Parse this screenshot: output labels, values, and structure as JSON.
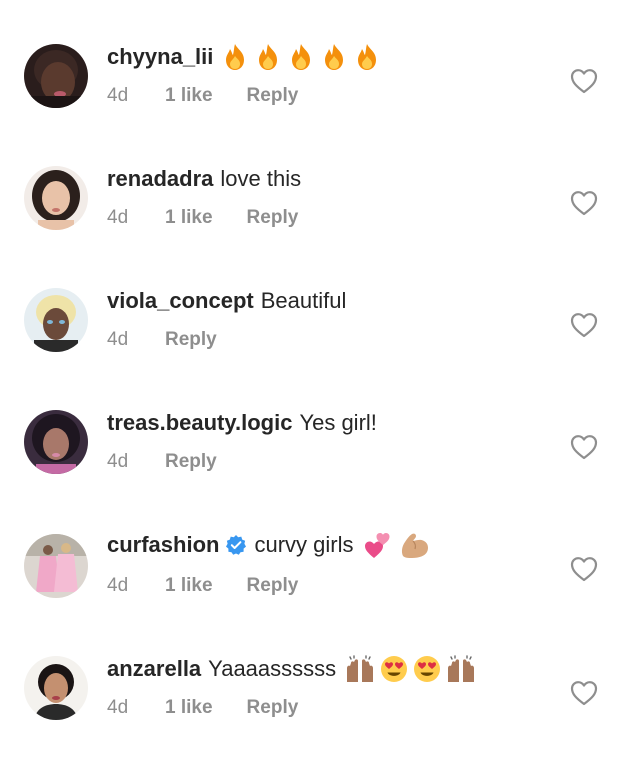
{
  "comments": [
    {
      "username": "chyyna_lii",
      "text": "",
      "emojis": [
        "fire",
        "fire",
        "fire",
        "fire",
        "fire"
      ],
      "verified": false,
      "age": "4d",
      "likes": "1 like",
      "reply": "Reply",
      "avatar": "avatar-chyyna-lii"
    },
    {
      "username": "renadadra",
      "text": "love this",
      "emojis": [],
      "verified": false,
      "age": "4d",
      "likes": "1 like",
      "reply": "Reply",
      "avatar": "avatar-renadadra"
    },
    {
      "username": "viola_concept",
      "text": "Beautiful",
      "emojis": [],
      "verified": false,
      "age": "4d",
      "likes": null,
      "reply": "Reply",
      "avatar": "avatar-viola-concept"
    },
    {
      "username": "treas.beauty.logic",
      "text": "Yes girl!",
      "emojis": [],
      "verified": false,
      "age": "4d",
      "likes": null,
      "reply": "Reply",
      "avatar": "avatar-treas-beauty-logic"
    },
    {
      "username": "curfashion",
      "text": "curvy girls",
      "emojis": [
        "two-hearts",
        "flexed-biceps"
      ],
      "verified": true,
      "age": "4d",
      "likes": "1 like",
      "reply": "Reply",
      "avatar": "avatar-curfashion"
    },
    {
      "username": "anzarella",
      "text": "Yaaaassssss",
      "emojis": [
        "raising-hands",
        "heart-eyes",
        "heart-eyes",
        "raising-hands"
      ],
      "verified": false,
      "age": "4d",
      "likes": "1 like",
      "reply": "Reply",
      "avatar": "avatar-anzarella"
    }
  ],
  "colors": {
    "username": "#262626",
    "meta": "#8e8e8e",
    "heart_outline": "#8e8e8e",
    "verified_badge": "#3897f0",
    "background": "#ffffff"
  },
  "icons": {
    "like": "heart-outline-icon",
    "verified": "verified-badge-icon"
  }
}
